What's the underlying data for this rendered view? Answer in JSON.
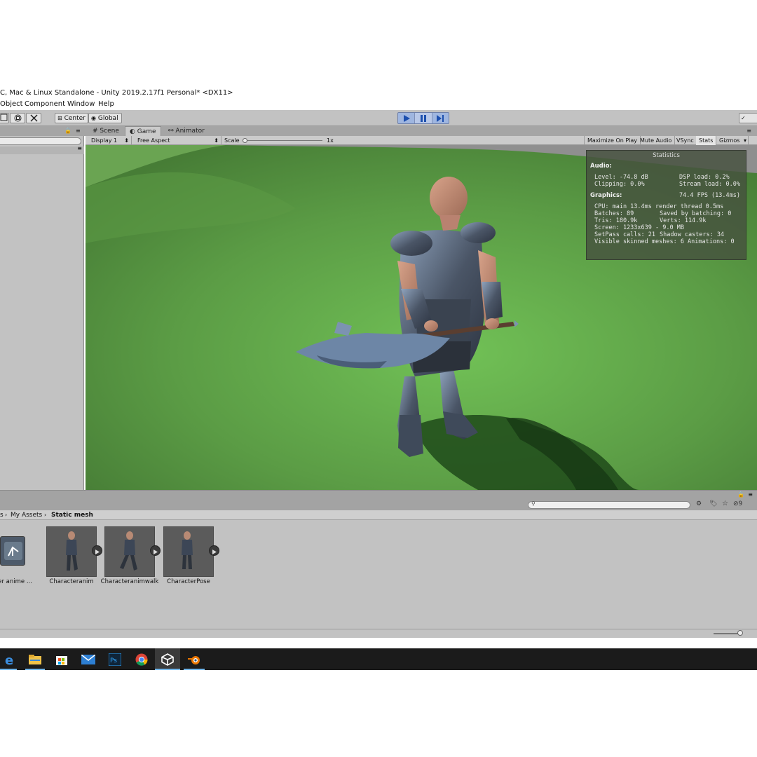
{
  "window": {
    "title": "C, Mac & Linux Standalone - Unity 2019.2.17f1 Personal* <DX11>"
  },
  "menu": [
    "Object",
    "Component",
    "Window",
    "Help"
  ],
  "toolbar": {
    "pivot_label": "Center",
    "space_label": "Global"
  },
  "tabs": [
    "Scene",
    "Game",
    "Animator"
  ],
  "game_bar": {
    "display": "Display 1",
    "aspect": "Free Aspect",
    "scale_label": "Scale",
    "scale_value": "1x",
    "maximize": "Maximize On Play",
    "mute": "Mute Audio",
    "vsync": "VSync",
    "stats": "Stats",
    "gizmos": "Gizmos"
  },
  "statistics": {
    "header": "Statistics",
    "audio_header": "Audio:",
    "level": "Level: -74.8 dB",
    "clipping": "Clipping: 0.0%",
    "dsp_load": "DSP load: 0.2%",
    "stream_load": "Stream load: 0.0%",
    "graphics_header": "Graphics:",
    "fps": "74.4 FPS (13.4ms)",
    "cpu": "CPU: main 13.4ms  render thread 0.5ms",
    "batches": "Batches: 89",
    "saved_batching": "Saved by batching: 0",
    "tris": "Tris: 180.9k",
    "verts": "Verts: 114.9k",
    "screen": "Screen: 1233x639 - 9.0 MB",
    "setpass": "SetPass calls: 21",
    "shadow_casters": "Shadow casters: 34",
    "skinned": "Visible skinned meshes: 6  Animations: 0"
  },
  "project": {
    "breadcrumb_sep": "s",
    "breadcrumb_1": "My Assets",
    "breadcrumb_2": "Static mesh",
    "hidden_count": "9",
    "assets": [
      {
        "label": "acter anime ..."
      },
      {
        "label": "Characteranim"
      },
      {
        "label": "Characteranimwalk"
      },
      {
        "label": "CharacterPose"
      }
    ]
  },
  "taskbar": [
    "edge-icon",
    "file-explorer-icon",
    "store-icon",
    "mail-icon",
    "photoshop-icon",
    "chrome-icon",
    "unity-icon",
    "blender-icon"
  ],
  "colors": {
    "grass": "#5d9e47",
    "play_active": "#9fb6e0",
    "taskbar": "#1b1b1b"
  }
}
